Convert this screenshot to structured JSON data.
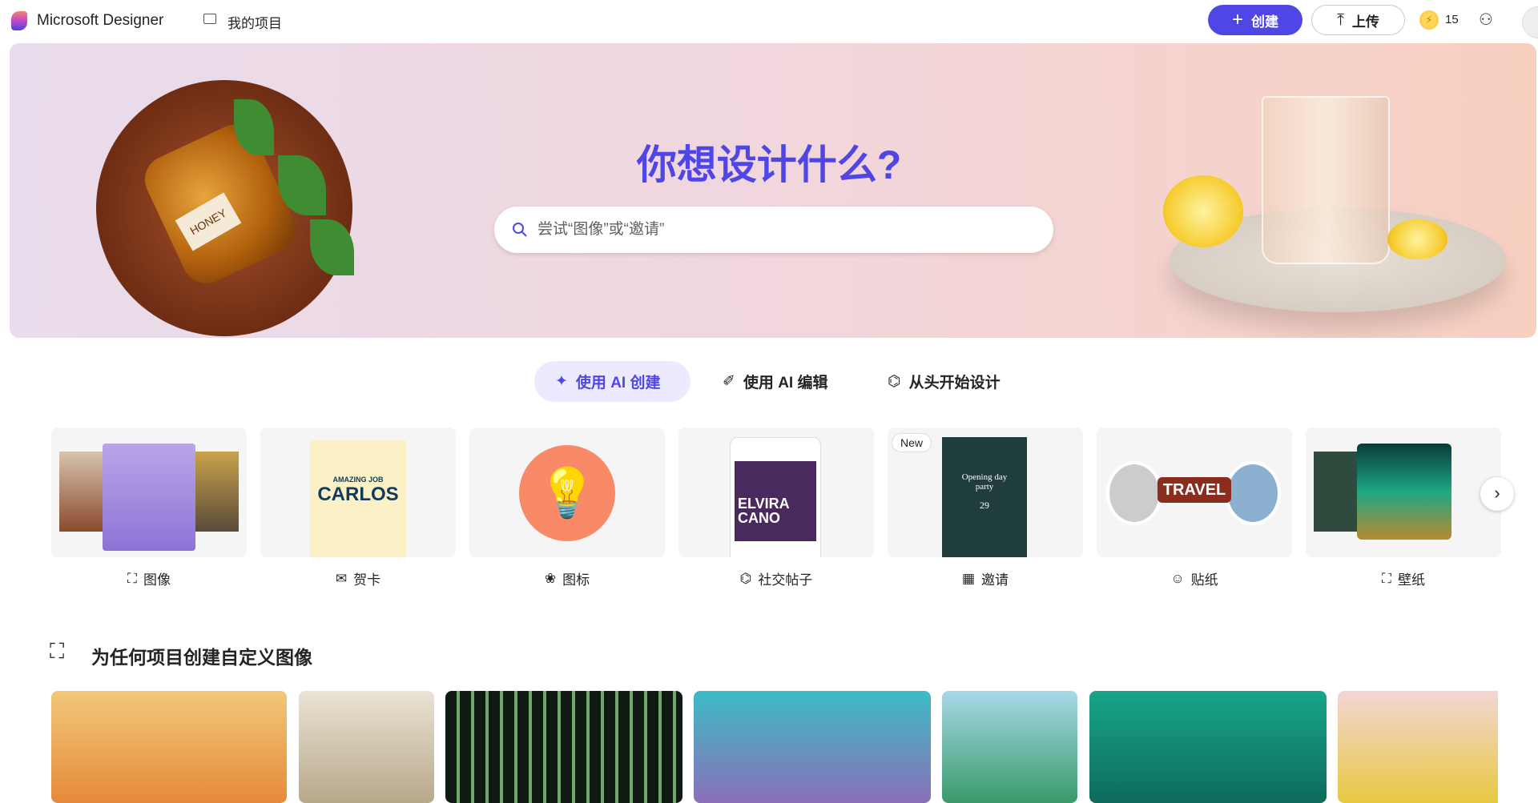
{
  "header": {
    "brand": "Microsoft Designer",
    "my_projects": "我的项目",
    "create": "创建",
    "upload": "上传",
    "credits": "15"
  },
  "hero": {
    "title": "你想设计什么?",
    "search_placeholder": "尝试“图像”或“邀请”",
    "honey_label": "HONEY"
  },
  "tabs": [
    {
      "label": "使用 AI 创建",
      "active": true
    },
    {
      "label": "使用 AI 编辑"
    },
    {
      "label": "从头开始设计"
    }
  ],
  "cards": [
    {
      "label": "图像",
      "icon": "image-sparkle-icon"
    },
    {
      "label": "贺卡",
      "icon": "mail-icon",
      "art": {
        "line1": "AMAZING JOB",
        "line2": "CARLOS"
      }
    },
    {
      "label": "图标",
      "icon": "shapes-icon"
    },
    {
      "label": "社交帖子",
      "icon": "social-post-icon",
      "art": {
        "name": "ELVIRA CANO"
      }
    },
    {
      "label": "邀请",
      "icon": "calendar-icon",
      "badge": "New",
      "art": {
        "title": "Opening day party",
        "day": "29"
      }
    },
    {
      "label": "贴纸",
      "icon": "sticker-icon",
      "art": {
        "text": "TRAVEL"
      }
    },
    {
      "label": "壁纸",
      "icon": "wallpaper-icon"
    }
  ],
  "section": {
    "title": "为任何项目创建自定义图像"
  },
  "colors": {
    "accent": "#4f46e5",
    "active_tab_bg": "#ede9fe"
  }
}
